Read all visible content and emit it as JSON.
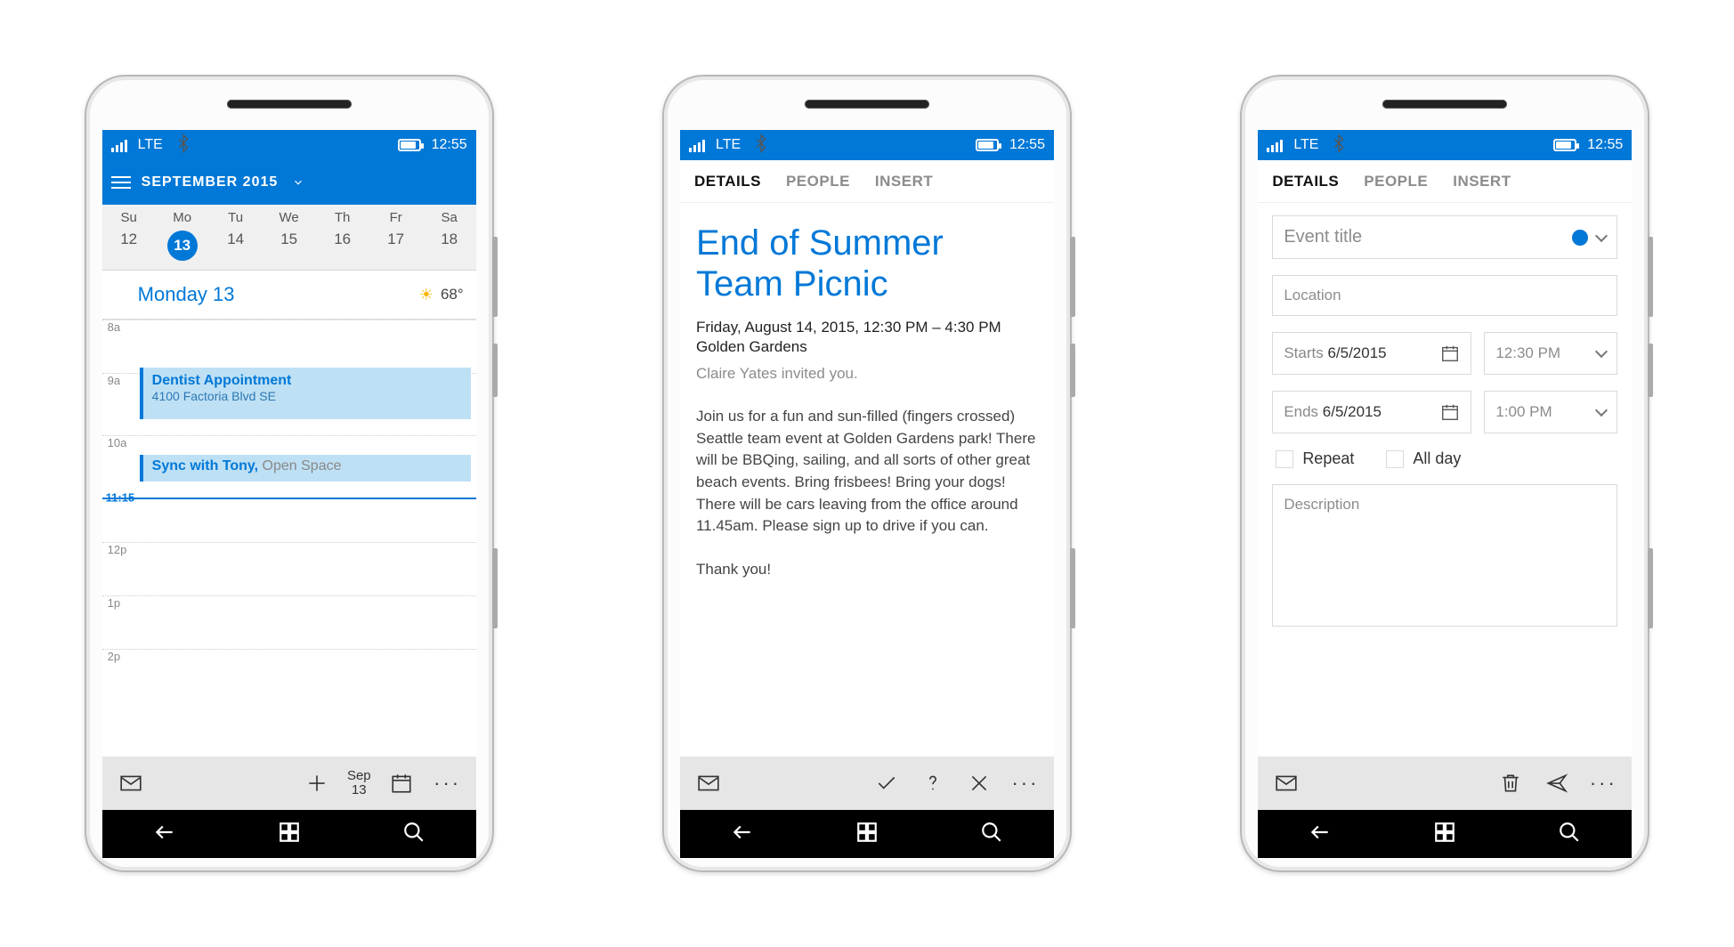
{
  "status": {
    "network": "LTE",
    "time": "12:55"
  },
  "nav_icons": {
    "back": "back-icon",
    "home": "windows-icon",
    "search": "search-icon"
  },
  "tabs": {
    "details": "DETAILS",
    "people": "PEOPLE",
    "insert": "INSERT"
  },
  "calendar": {
    "month_label": "SEPTEMBER 2015",
    "day_abbrev": [
      "Su",
      "Mo",
      "Tu",
      "We",
      "Th",
      "Fr",
      "Sa"
    ],
    "dates": [
      "12",
      "13",
      "14",
      "15",
      "16",
      "17",
      "18"
    ],
    "selected_index": 1,
    "day_title": "Monday 13",
    "temperature": "68°",
    "hours": [
      "8a",
      "9a",
      "10a",
      "",
      "12p",
      "1p",
      "2p"
    ],
    "now_label": "11:15",
    "events": [
      {
        "title": "Dentist Appointment",
        "location": "4100 Factoria Blvd SE"
      },
      {
        "title": "Sync with Tony,",
        "location": "Open Space"
      }
    ],
    "today_btn": {
      "month": "Sep",
      "day": "13"
    }
  },
  "detail": {
    "title": "End of Summer Team Picnic",
    "datetime": "Friday, August 14, 2015, 12:30 PM – 4:30 PM",
    "location": "Golden Gardens",
    "inviter": "Claire Yates invited you.",
    "body": "Join us for a fun and sun-filled (fingers crossed) Seattle team event at Golden Gardens park! There will be BBQing, sailing, and all sorts of other great beach events. Bring frisbees! Bring your dogs! There will be cars leaving from the office around 11.45am. Please sign up to drive if you can.\n\nThank you!"
  },
  "compose": {
    "title_placeholder": "Event title",
    "location_placeholder": "Location",
    "start_label": "Starts",
    "start_date": "6/5/2015",
    "start_time": "12:30 PM",
    "end_label": "Ends",
    "end_date": "6/5/2015",
    "end_time": "1:00 PM",
    "repeat_label": "Repeat",
    "allday_label": "All day",
    "desc_placeholder": "Description"
  }
}
